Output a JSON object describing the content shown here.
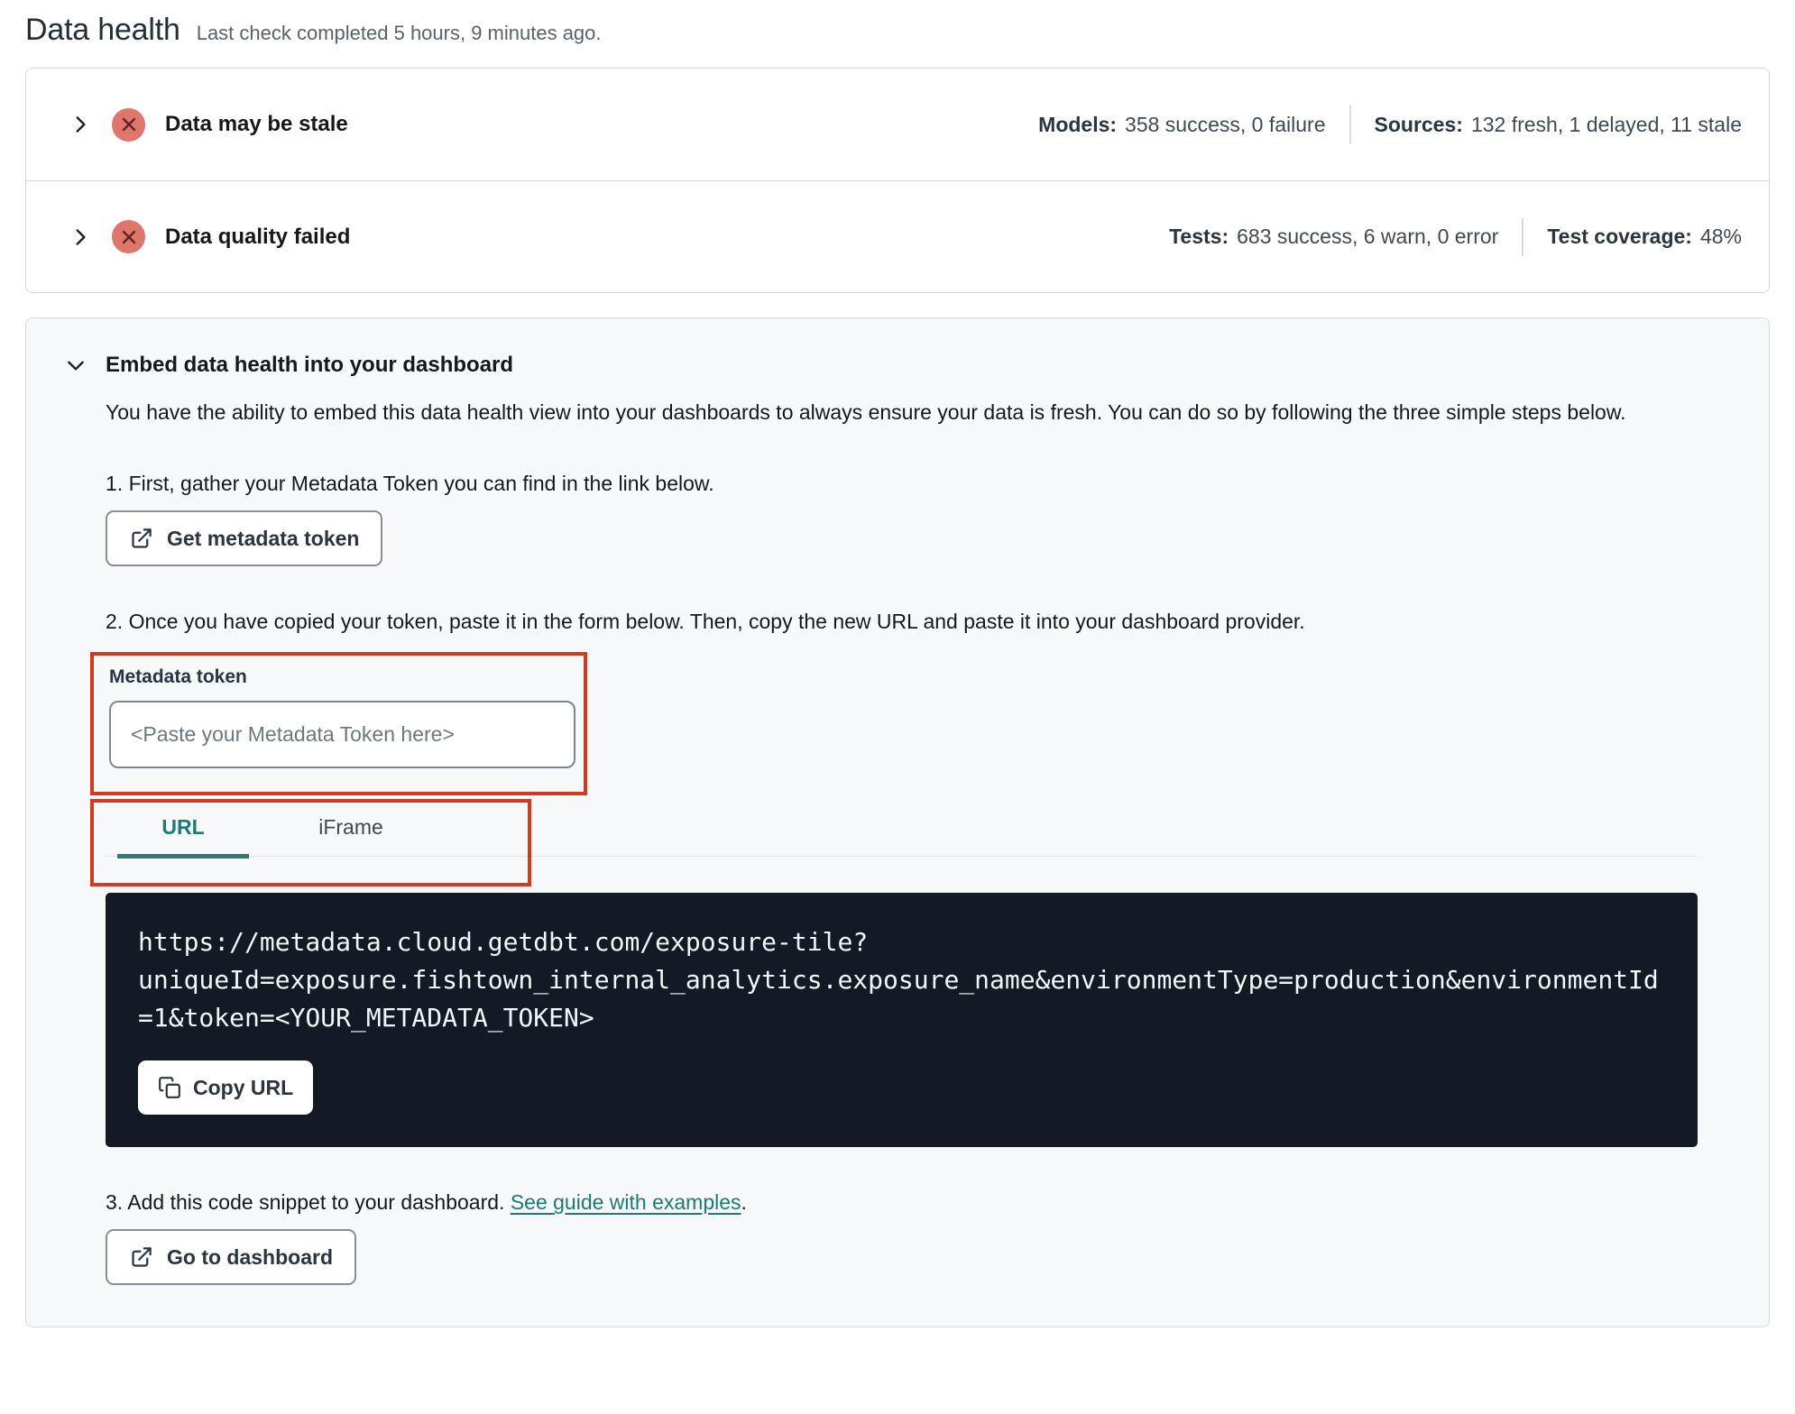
{
  "page": {
    "title": "Data health",
    "subtitle": "Last check completed 5 hours, 9 minutes ago."
  },
  "status_rows": [
    {
      "title": "Data may be stale",
      "stats": [
        {
          "label": "Models:",
          "value": "358 success, 0 failure"
        },
        {
          "label": "Sources:",
          "value": "132 fresh, 1 delayed, 11 stale"
        }
      ]
    },
    {
      "title": "Data quality failed",
      "stats": [
        {
          "label": "Tests:",
          "value": "683 success, 6 warn, 0 error"
        },
        {
          "label": "Test coverage:",
          "value": "48%"
        }
      ]
    }
  ],
  "embed": {
    "heading": "Embed data health into your dashboard",
    "description": "You have the ability to embed this data health view into your dashboards to always ensure your data is fresh. You can do so by following the three simple steps below.",
    "step1": "1. First, gather your Metadata Token you can find in the link below.",
    "get_token_button": "Get metadata token",
    "step2": "2. Once you have copied your token, paste it in the form below. Then, copy the new URL and paste it into your dashboard provider.",
    "token_label": "Metadata token",
    "token_placeholder": "<Paste your Metadata Token here>",
    "token_value": "",
    "tabs": [
      {
        "label": "URL",
        "active": true
      },
      {
        "label": "iFrame",
        "active": false
      }
    ],
    "code_url": "https://metadata.cloud.getdbt.com/exposure-tile?uniqueId=exposure.fishtown_internal_analytics.exposure_name&environmentType=production&environmentId=1&token=<YOUR_METADATA_TOKEN>",
    "copy_button": "Copy URL",
    "step3_prefix": "3. Add this code snippet to your dashboard. ",
    "step3_link": "See guide with examples",
    "step3_suffix": ".",
    "dashboard_button": "Go to dashboard"
  },
  "colors": {
    "annotation_red": "#d23a20",
    "status_error_bg": "#e0756c",
    "status_error_glyph": "#5c2523",
    "accent_teal": "#1e7b74",
    "code_block_bg": "#131a26",
    "card_bg": "#f7f8f9",
    "border": "#d6d9dc"
  },
  "icons": {
    "row_toggle": "chevron-right-icon",
    "section_toggle": "chevron-down-icon",
    "status_error": "x-circle-icon",
    "external_link": "external-link-icon",
    "copy": "copy-icon"
  }
}
